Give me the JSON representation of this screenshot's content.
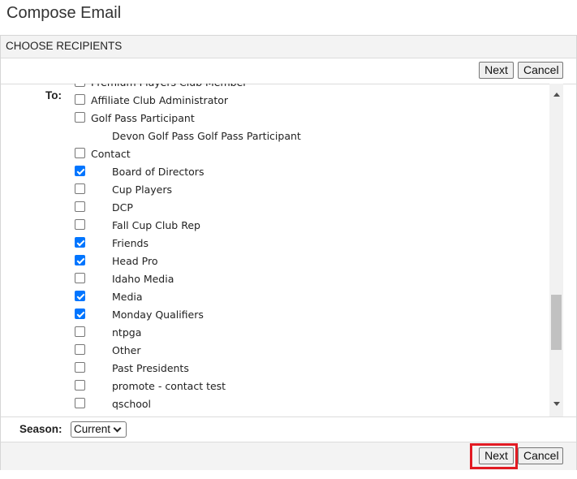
{
  "page": {
    "title": "Compose Email"
  },
  "panel": {
    "title": "CHOOSE RECIPIENTS"
  },
  "toolbar": {
    "next_label": "Next",
    "cancel_label": "Cancel"
  },
  "recipients": {
    "to_label": "To:",
    "items": [
      {
        "label": "Premium Players Club Member",
        "checked": false,
        "indent": 0
      },
      {
        "label": "Affiliate Club Administrator",
        "checked": false,
        "indent": 0
      },
      {
        "label": "Golf Pass Participant",
        "checked": false,
        "indent": 0
      },
      {
        "label": "Devon Golf Pass Golf Pass Participant",
        "checked": null,
        "indent": 1
      },
      {
        "label": "Contact",
        "checked": false,
        "indent": 0
      },
      {
        "label": "Board of Directors",
        "checked": true,
        "indent": 1
      },
      {
        "label": "Cup Players",
        "checked": false,
        "indent": 1
      },
      {
        "label": "DCP",
        "checked": false,
        "indent": 1
      },
      {
        "label": "Fall Cup Club Rep",
        "checked": false,
        "indent": 1
      },
      {
        "label": "Friends",
        "checked": true,
        "indent": 1
      },
      {
        "label": "Head Pro",
        "checked": true,
        "indent": 1
      },
      {
        "label": "Idaho Media",
        "checked": false,
        "indent": 1
      },
      {
        "label": "Media",
        "checked": true,
        "indent": 1
      },
      {
        "label": "Monday Qualifiers",
        "checked": true,
        "indent": 1
      },
      {
        "label": "ntpga",
        "checked": false,
        "indent": 1
      },
      {
        "label": "Other",
        "checked": false,
        "indent": 1
      },
      {
        "label": "Past Presidents",
        "checked": false,
        "indent": 1
      },
      {
        "label": "promote - contact test",
        "checked": false,
        "indent": 1
      },
      {
        "label": "qschool",
        "checked": false,
        "indent": 1
      }
    ]
  },
  "season": {
    "label": "Season:",
    "selected": "Current"
  },
  "icons": {
    "dropdown": "chevron-down-icon",
    "scroll_up": "arrow-up-icon",
    "scroll_down": "arrow-down-icon"
  },
  "colors": {
    "checkbox_checked": "#0075ff",
    "highlight": "#e21b23"
  }
}
